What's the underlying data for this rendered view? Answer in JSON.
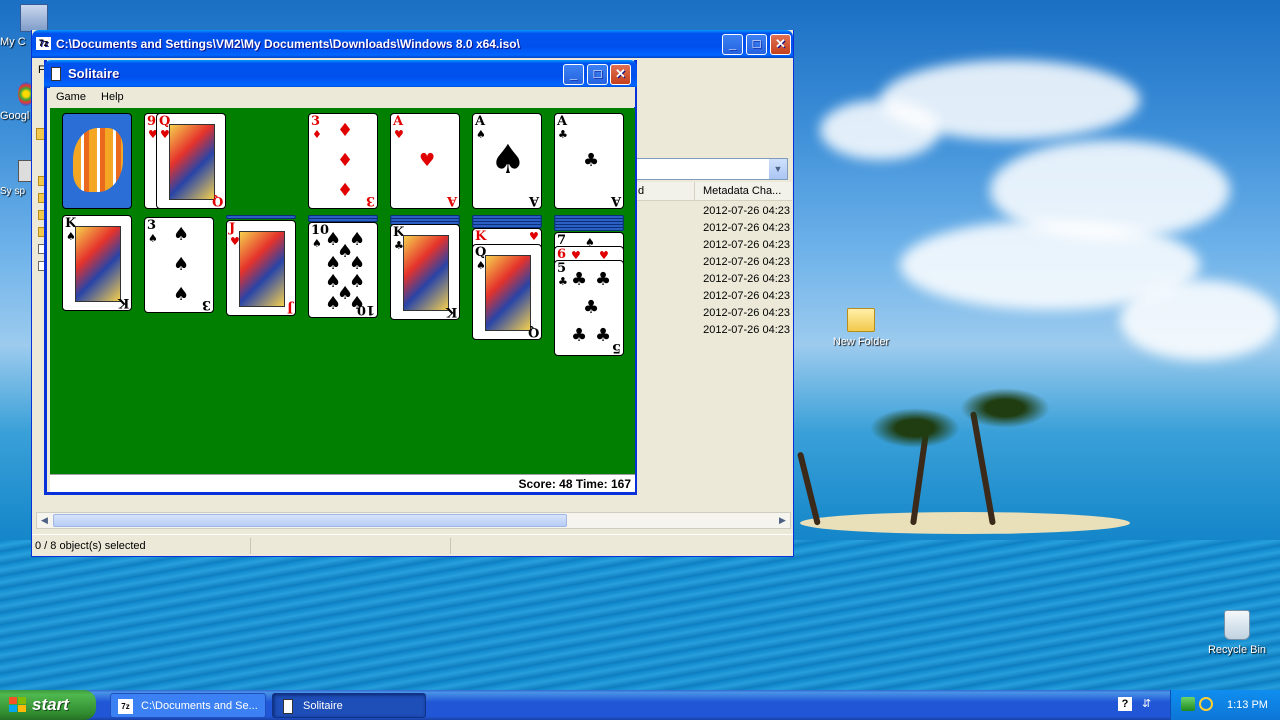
{
  "desktop": {
    "icons": [
      {
        "label": "My C"
      },
      {
        "label": "Googl"
      },
      {
        "label": "Sy sp"
      },
      {
        "label": "New Folder"
      },
      {
        "label": "Recycle Bin"
      }
    ]
  },
  "explorer": {
    "title": "C:\\Documents and Settings\\VM2\\My Documents\\Downloads\\Windows 8.0 x64.iso\\",
    "column_header_partial": "d",
    "column_header_metadata": "Metadata Cha...",
    "dates": [
      "2012-07-26 04:23",
      "2012-07-26 04:23",
      "2012-07-26 04:23",
      "2012-07-26 04:23",
      "2012-07-26 04:23",
      "2012-07-26 04:23",
      "2012-07-26 04:23",
      "2012-07-26 04:23"
    ],
    "status": "0 / 8 object(s) selected"
  },
  "solitaire": {
    "title": "Solitaire",
    "menu": {
      "game": "Game",
      "help": "Help"
    },
    "score_line": "Score: 48 Time: 167",
    "stock_card_back": "tropical-fish-back",
    "waste_top": {
      "rank": "Q",
      "suit": "♥",
      "under_rank": "9",
      "under_suit": "♥"
    },
    "foundations": [
      {
        "rank": "3",
        "suit": "♦"
      },
      {
        "rank": "A",
        "suit": "♥"
      },
      {
        "rank": "A",
        "suit": "♠"
      },
      {
        "rank": "A",
        "suit": "♣"
      }
    ],
    "tableau": [
      {
        "top_rank": "K",
        "top_suit": "♠"
      },
      {
        "top_rank": "3",
        "top_suit": "♠"
      },
      {
        "top_rank": "J",
        "top_suit": "♥"
      },
      {
        "top_rank": "10",
        "top_suit": "♠"
      },
      {
        "top_rank": "K",
        "top_suit": "♣"
      },
      {
        "under_rank": "K",
        "under_suit": "♥",
        "top_rank": "Q",
        "top_suit": "♠"
      },
      {
        "under1_rank": "7",
        "under1_suit": "♠",
        "under2_rank": "6",
        "under2_suit": "♥",
        "top_rank": "5",
        "top_suit": "♣"
      }
    ]
  },
  "taskbar": {
    "start": "start",
    "buttons": [
      {
        "label": "C:\\Documents and Se..."
      },
      {
        "label": "Solitaire"
      }
    ],
    "clock": "1:13 PM"
  },
  "colors": {
    "felt": "#007f00",
    "xp_title_blue": "#0053ee",
    "start_green": "#3c9a3c"
  }
}
